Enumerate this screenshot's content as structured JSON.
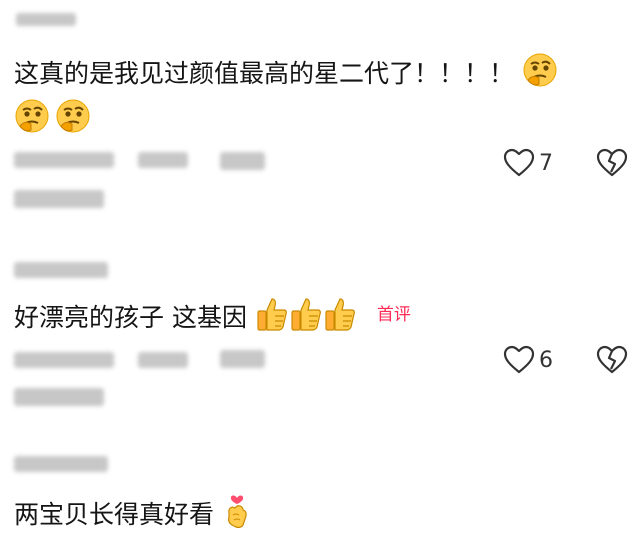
{
  "comments": [
    {
      "text": "这真的是我见过颜值最高的星二代了！！！！",
      "emoji_inline": "thinking-face-emoji",
      "emoji_line2": [
        "thinking-face-emoji",
        "thinking-face-emoji"
      ],
      "like_count": "7"
    },
    {
      "text": "好漂亮的孩子 这基因",
      "emoji_inline": [
        "thumbs-up-emoji",
        "thumbs-up-emoji",
        "thumbs-up-emoji"
      ],
      "tag": "首评",
      "like_count": "6"
    },
    {
      "text": "两宝贝长得真好看",
      "emoji_inline": "finger-heart-emoji"
    }
  ],
  "colors": {
    "tag": "#ff2a55",
    "icon": "#333333",
    "blurred_meta": "#b5b5b5"
  }
}
